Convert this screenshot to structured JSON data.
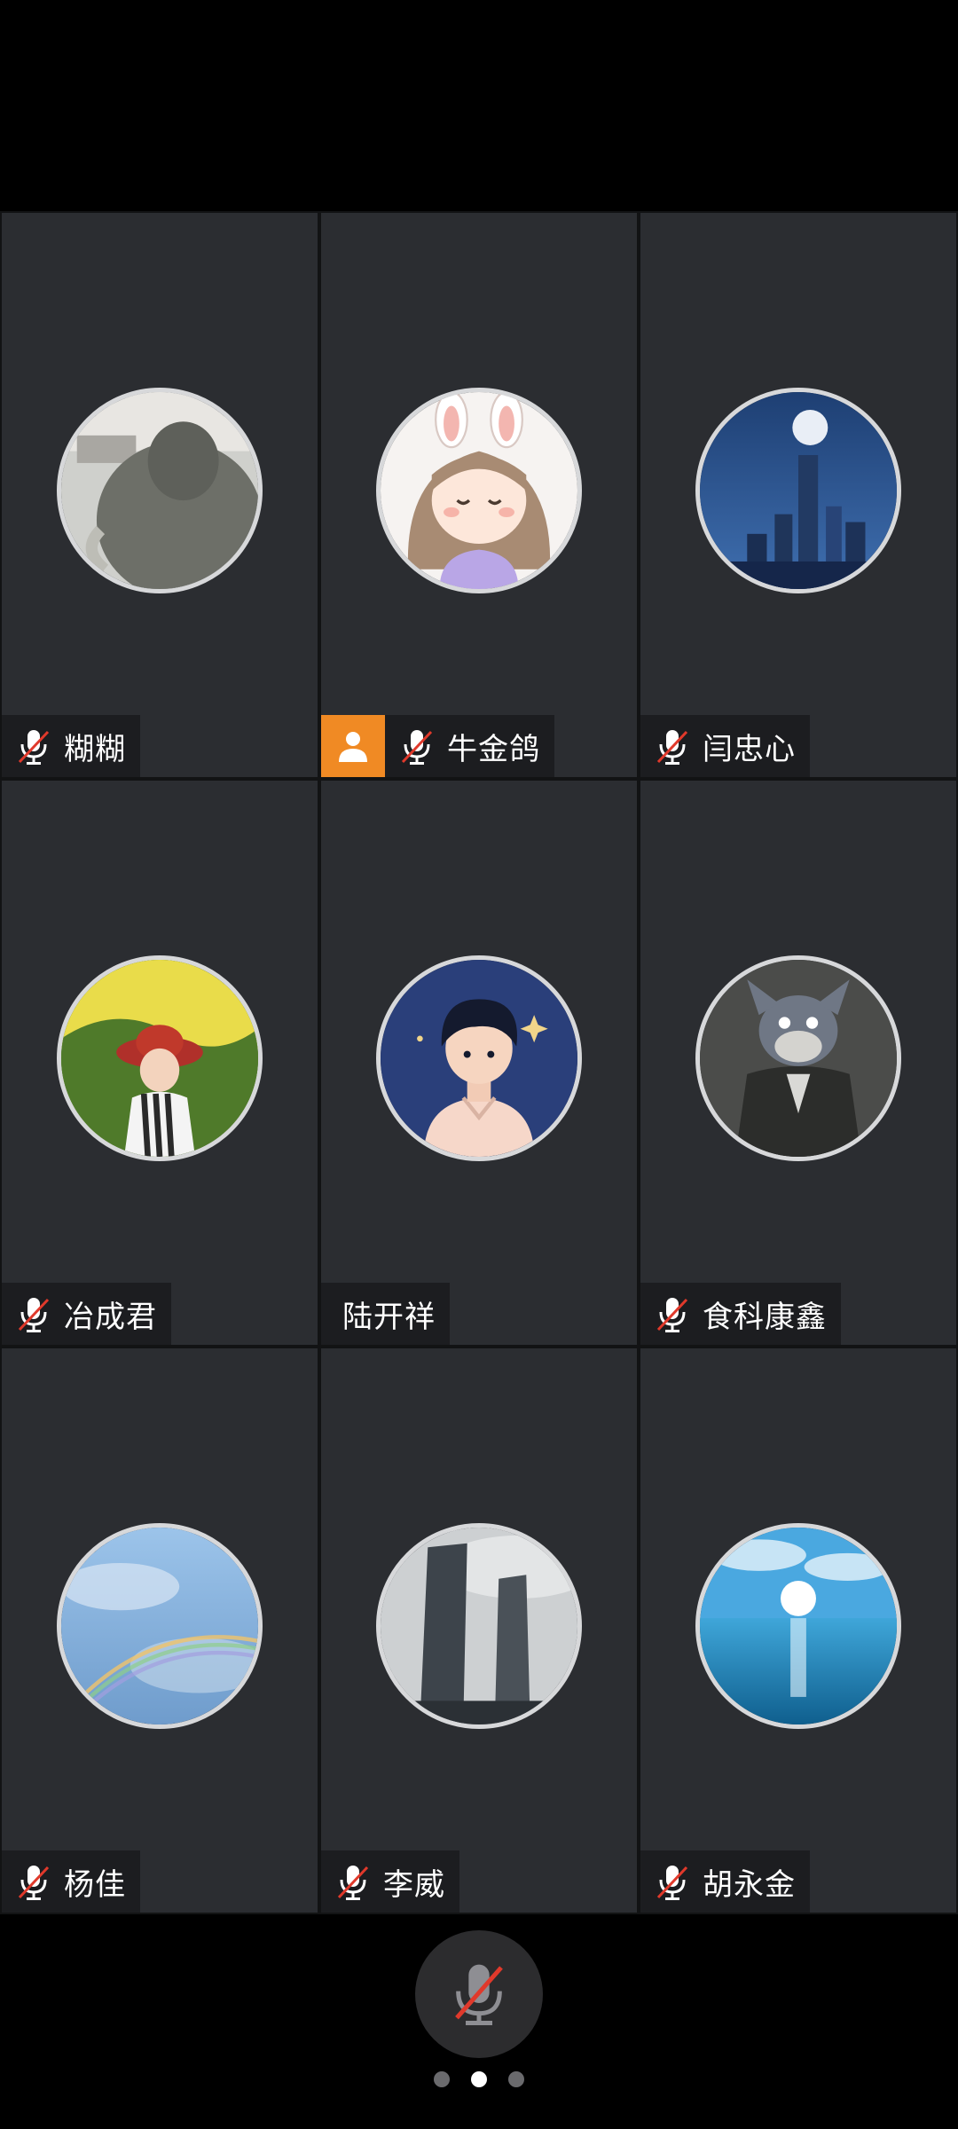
{
  "participants": [
    {
      "name": "糊糊",
      "muted": true,
      "host": false,
      "avatar": "elephant-photo-avatar"
    },
    {
      "name": "牛金鸽",
      "muted": true,
      "host": true,
      "avatar": "cartoon-girl-bunny-ears-avatar"
    },
    {
      "name": "闫忠心",
      "muted": true,
      "host": false,
      "avatar": "city-moon-night-avatar"
    },
    {
      "name": "冶成君",
      "muted": true,
      "host": false,
      "avatar": "child-red-hat-avatar"
    },
    {
      "name": "陆开祥",
      "muted": false,
      "host": false,
      "avatar": "cartoon-boy-avatar"
    },
    {
      "name": "食科康鑫",
      "muted": true,
      "host": false,
      "avatar": "cartoon-cat-suit-avatar"
    },
    {
      "name": "杨佳",
      "muted": true,
      "host": false,
      "avatar": "rainbow-sky-avatar"
    },
    {
      "name": "李威",
      "muted": true,
      "host": false,
      "avatar": "twin-towers-avatar"
    },
    {
      "name": "胡永金",
      "muted": true,
      "host": false,
      "avatar": "sea-sun-avatar"
    }
  ],
  "bottom": {
    "mic_button": {
      "state": "muted",
      "icon": "mic-muted-icon"
    },
    "page_indicator": {
      "pages": 3,
      "current": 2
    }
  },
  "colors": {
    "tile_bg": "#2b2d31",
    "host_badge": "#f08a24",
    "mute_slash": "#e0392b"
  }
}
